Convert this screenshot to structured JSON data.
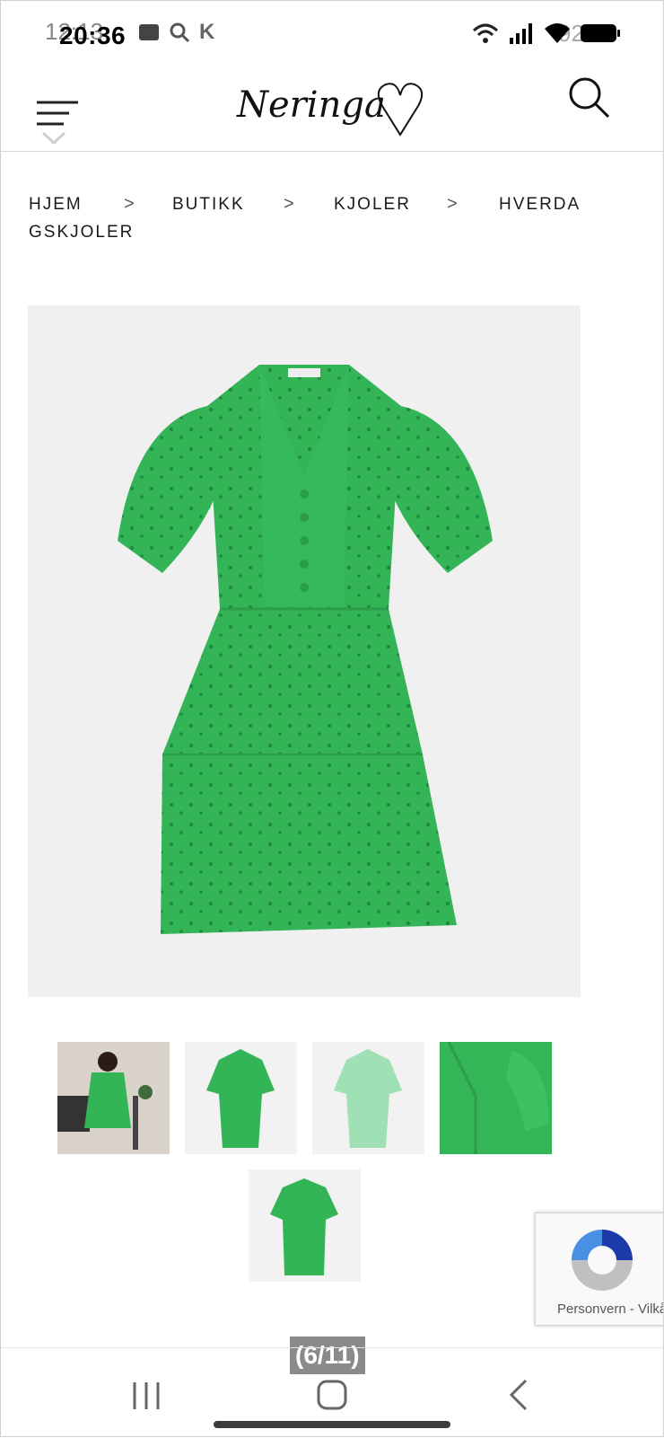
{
  "status_bar": {
    "time": "20:36",
    "time_ghost": "12:13",
    "battery": "92%",
    "notification_letter": "K"
  },
  "header": {
    "logo_text": "Neringa",
    "icons": [
      "menu-icon",
      "close-icon",
      "search-icon",
      "heart-icon"
    ]
  },
  "breadcrumb": {
    "items": [
      "HJEM",
      "BUTIKK",
      "KJOLER",
      "HVERDA",
      "GSKJOLER"
    ],
    "separator": ">"
  },
  "product": {
    "main_image_color": "#33b457",
    "thumbnails_count": 5
  },
  "recaptcha": {
    "label": "Personvern - Vilkår"
  },
  "gallery": {
    "counter": "(6/11)"
  },
  "colors": {
    "dress_green": "#33b457",
    "dress_mint": "#9fe0b4",
    "background_gray": "#f0f0f0"
  }
}
